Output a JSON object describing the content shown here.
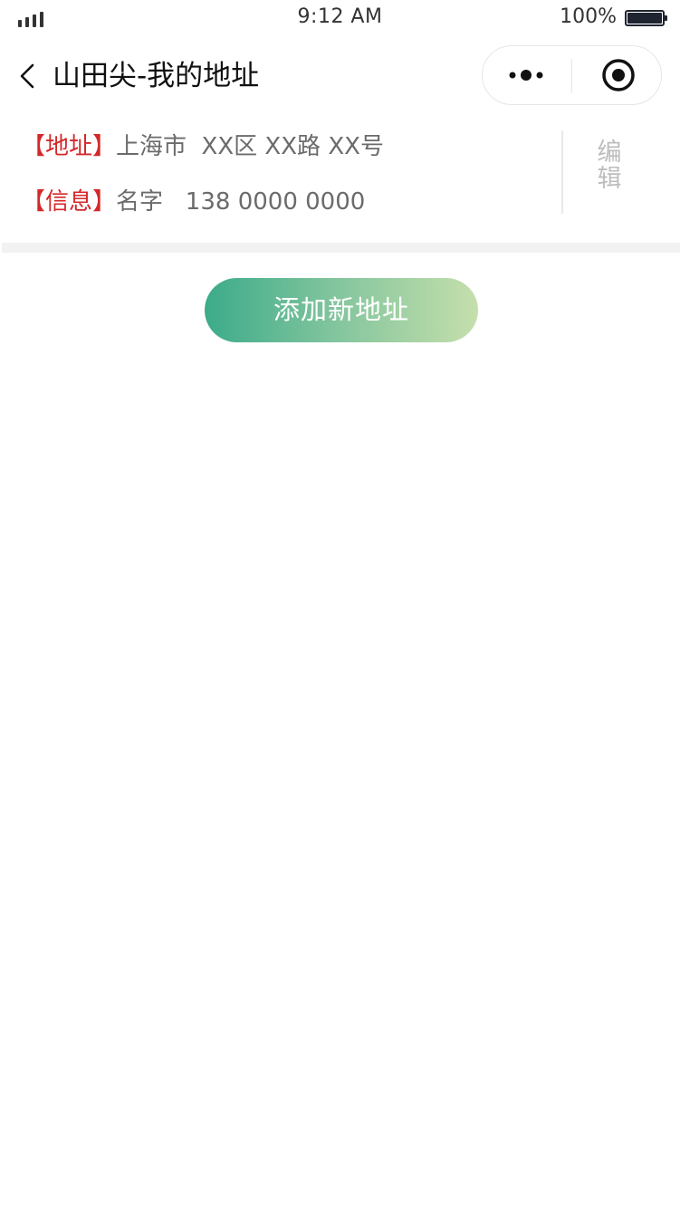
{
  "status_bar": {
    "time": "9:12 AM",
    "battery_percent": "100%"
  },
  "nav": {
    "title": "山田尖-我的地址"
  },
  "address": {
    "address_tag": "【地址】",
    "address_value": "上海市  XX区 XX路 XX号",
    "info_tag": "【信息】",
    "info_value": "名字   138 0000 0000",
    "edit_label": "编辑"
  },
  "actions": {
    "add_label": "添加新地址"
  },
  "colors": {
    "tag_red": "#d4282a",
    "button_gradient_start": "#3cab8a",
    "button_gradient_end": "#c5dfac",
    "edit_gray": "#bdbdbd"
  },
  "icons": {
    "back": "chevron-left-icon",
    "more": "more-dots-icon",
    "close": "target-circle-icon",
    "signal": "signal-icon",
    "battery": "battery-icon"
  }
}
